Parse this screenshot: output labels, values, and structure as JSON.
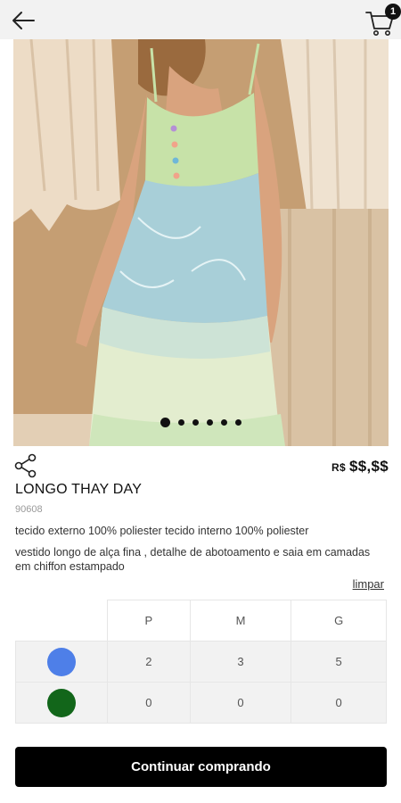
{
  "header": {
    "back_icon": "arrow-left-icon",
    "cart_icon": "shopping-cart-icon",
    "cart_count": "1"
  },
  "gallery": {
    "dots_count": 6,
    "active_index": 0,
    "colors": {
      "background": "#c9a57c",
      "fabric": "#e8d3bb",
      "bodice": "#c7e2a8",
      "skirt_top": "#a8cfd8",
      "skirt_bottom": "#e6efcf"
    }
  },
  "product": {
    "share_icon": "share-icon",
    "currency": "R$",
    "price": "$$,$$",
    "name": "LONGO THAY DAY",
    "sku": "90608",
    "description_fabric": "tecido externo 100% poliester tecido interno 100% poliester",
    "description_style": "vestido longo de alça fina , detalhe de abotoamento e saia em camadas em chiffon estampado"
  },
  "stock": {
    "clear_label": "limpar",
    "sizes": [
      "P",
      "M",
      "G"
    ],
    "rows": [
      {
        "color": "#4e7fe8",
        "quantities": [
          "2",
          "3",
          "5"
        ]
      },
      {
        "color": "#12661a",
        "quantities": [
          "0",
          "0",
          "0"
        ]
      }
    ]
  },
  "actions": {
    "continue_label": "Continuar comprando"
  }
}
